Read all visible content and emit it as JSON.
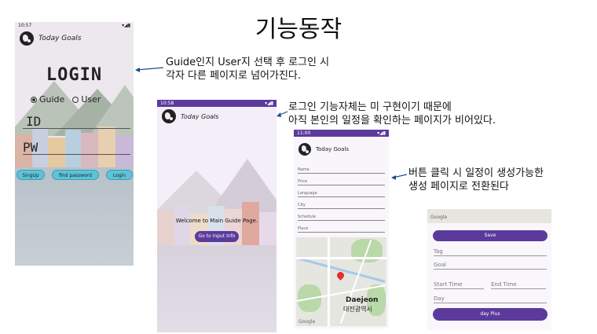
{
  "slide": {
    "title": "기능동작",
    "note1_line1": "Guide인지 User지 선택 후 로그인 시",
    "note1_line2": "각자 다른 페이지로 넘어가진다.",
    "note2_line1": "로그인 기능자체는 미 구현이기 때문에",
    "note2_line2": "아직 본인의 일정을 확인하는 페이지가 비어있다.",
    "note3_line1": "버튼 클릭 시 일정이 생성가능한",
    "note3_line2": "생성 페이지로 전환된다"
  },
  "phone1": {
    "time": "10:57",
    "app_name": "Today Goals",
    "login_title": "LOGIN",
    "radio_guide": "Guide",
    "radio_user": "User",
    "id_label": "ID",
    "pw_label": "PW",
    "signup": "SingUp",
    "find_password": "find password",
    "login": "Login"
  },
  "phone2": {
    "time": "10:58",
    "app_name": "Today Goals",
    "welcome": "Welcome to Main Guide Page.",
    "go_button": "Go to Input Info"
  },
  "phone3": {
    "time": "11:00",
    "app_name": "Today Goals",
    "fields": [
      "Name",
      "Price",
      "Language",
      "City",
      "Schedule",
      "Place"
    ],
    "map_city_en": "Daejeon",
    "map_city_ko": "대전광역시",
    "map_brand": "Google"
  },
  "phone4": {
    "map_brand": "Google",
    "save": "Save",
    "tag": "Tag",
    "goal": "Goal",
    "start_time": "Start Time",
    "end_time": "End Time",
    "day": "Day",
    "day_plus": "day Plus"
  },
  "colors": {
    "accent_purple": "#5b3a9c",
    "login_button_cyan": "#5fc2d6",
    "annotation_red": "#d33"
  }
}
